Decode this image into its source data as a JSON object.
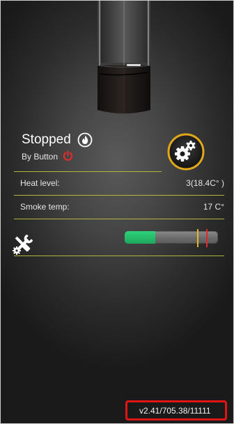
{
  "status": {
    "state": "Stopped",
    "reason": "By Button"
  },
  "rows": {
    "heat_level_label": "Heat level:",
    "heat_level_value": "3(18.4C° )",
    "smoke_temp_label": "Smoke temp:",
    "smoke_temp_value": "17 C°"
  },
  "level_bar": {
    "fill_fraction": 0.33
  },
  "footer": {
    "version": "v2.41/705.38/11111"
  },
  "colors": {
    "accent_line": "#b7b53a",
    "settings_ring": "#e2a81a",
    "power_icon": "#e02a2a",
    "bar_fill": "#2fd27a",
    "marker_yellow": "#e5b52a",
    "marker_red": "#e02a2a",
    "version_highlight": "#e01515"
  },
  "icons": {
    "flame": "flame-icon",
    "power": "power-icon",
    "settings": "gear-icon",
    "tools": "wrench-screwdriver-icon"
  }
}
